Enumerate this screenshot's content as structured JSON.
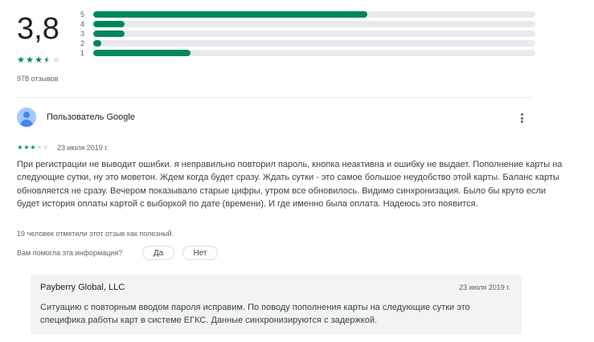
{
  "summary": {
    "average": "3,8",
    "stars": [
      "full",
      "full",
      "full",
      "half",
      "empty"
    ],
    "review_count": "978 отзывов",
    "distribution": [
      {
        "label": "5",
        "fraction": 0.62
      },
      {
        "label": "4",
        "fraction": 0.07
      },
      {
        "label": "3",
        "fraction": 0.07
      },
      {
        "label": "2",
        "fraction": 0.018
      },
      {
        "label": "1",
        "fraction": 0.22
      }
    ]
  },
  "review": {
    "author": "Пользователь Google",
    "stars": [
      "full",
      "full",
      "full",
      "empty",
      "empty"
    ],
    "date": "23 июля 2019 г.",
    "text": "При регистрации не выводит ошибки. я неправильно повторил пароль, кнопка неактивна и ошибку не выдает. Пополнение карты на следующие сутки, ну это моветон. Ждем когда будет сразу. Ждать сутки - это самое большое неудобство этой карты. Баланс карты обновляется не сразу. Вечером показывало старые цифры, утром все обновилось. Видимо синхронизация. Было бы круто если будет история оплаты картой с выборкой по дате (времени). И где именно была оплата. Надеюсь это появится.",
    "helpful_text": "19 человек отметили этот отзыв как полезный.",
    "question": "Вам помогла эта информация?",
    "yes_label": "Да",
    "no_label": "Нет"
  },
  "reply": {
    "author": "Payberry Global, LLC",
    "date": "23 июля 2019 г.",
    "text": "Ситуацию с повторным вводом пароля исправим. По поводу пополнения карты на следующие сутки это специфика работы карт в системе ЕГКС. Данные синхронизируются с задержкой."
  },
  "colors": {
    "accent": "#01875f",
    "track": "#e8eaed",
    "reply_bg": "#f1f3f4"
  },
  "icons": {
    "avatar": "default-user-avatar-icon",
    "more": "more-vert-icon",
    "star": "star-icon"
  }
}
